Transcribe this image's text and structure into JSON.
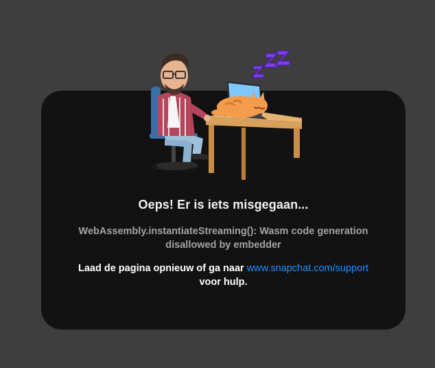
{
  "error_page": {
    "title": "Oeps! Er is iets misgegaan...",
    "error_message": "WebAssembly.instantiateStreaming(): Wasm code generation disallowed by embedder",
    "help_prefix": "Laad de pagina opnieuw of ga naar ",
    "help_link": "www.snapchat.com/support",
    "help_suffix": "voor hulp.",
    "illustration": "sleeping-cat-on-laptop-with-bitmoji"
  },
  "colors": {
    "page_background": "#3e3e3e",
    "card_background": "#121212",
    "link": "#1e90ff",
    "zzz": "#7b3fe4"
  }
}
